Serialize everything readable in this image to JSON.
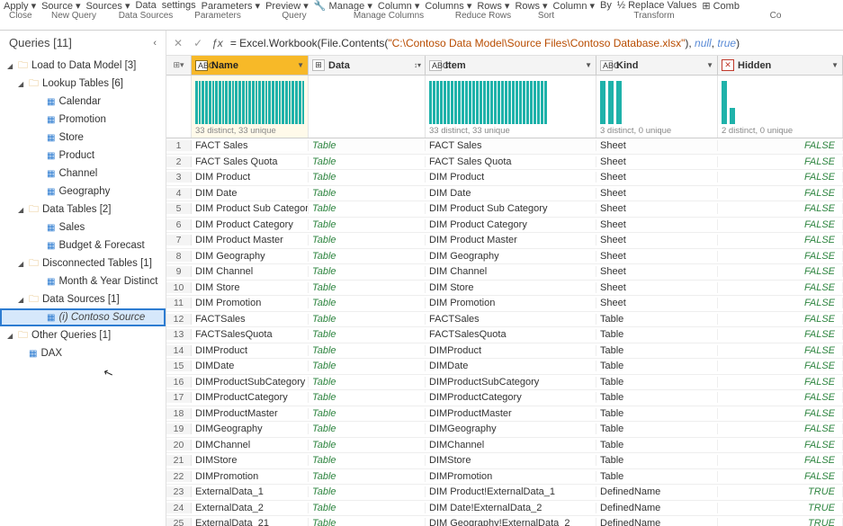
{
  "ribbon": {
    "top": [
      "Apply ▾",
      "Source ▾",
      "Sources ▾",
      "Data",
      "settings",
      "Parameters ▾",
      "Preview ▾",
      "🔧 Manage ▾",
      "Column ▾",
      "Columns ▾",
      "Rows ▾",
      "Rows ▾",
      "Column ▾",
      "By",
      "½ Replace Values",
      "⊞ Comb"
    ],
    "groups": {
      "close": "Close",
      "newq": "New Query",
      "ds": "Data Sources",
      "param": "Parameters",
      "query": "Query",
      "mc": "Manage Columns",
      "rr": "Reduce Rows",
      "sort": "Sort",
      "tr": "Transform",
      "co": "Co"
    }
  },
  "sidebar": {
    "title": "Queries [11]",
    "root": {
      "label": "Load to Data Model [3]"
    },
    "groups": [
      {
        "label": "Lookup Tables [6]",
        "items": [
          "Calendar",
          "Promotion",
          "Store",
          "Product",
          "Channel",
          "Geography"
        ]
      },
      {
        "label": "Data Tables [2]",
        "items": [
          "Sales",
          "Budget & Forecast"
        ]
      },
      {
        "label": "Disconnected Tables [1]",
        "items": [
          "Month & Year Distinct"
        ]
      },
      {
        "label": "Data Sources [1]",
        "items_special": [
          {
            "label": "(i) Contoso Source",
            "selected": true
          }
        ]
      }
    ],
    "other": {
      "label": "Other Queries [1]",
      "items": [
        "DAX"
      ]
    }
  },
  "formula": {
    "eq": "= ",
    "fn1": "Excel.Workbook",
    "lp1": "(",
    "fn2": "File.Contents",
    "lp2": "(",
    "str": "\"C:\\Contoso Data Model\\Source Files\\Contoso Database.xlsx\"",
    "rp2": "), ",
    "nul": "null",
    "comma": ", ",
    "tru": "true",
    "rp1": ")"
  },
  "columns": {
    "name": {
      "type": "ABC",
      "label": "Name"
    },
    "data": {
      "type": "⊞",
      "label": "Data"
    },
    "item": {
      "type": "ABC",
      "label": "Item"
    },
    "kind": {
      "type": "ABC",
      "label": "Kind"
    },
    "hidden": {
      "type": "✕",
      "label": "Hidden"
    }
  },
  "profiles": {
    "name": "33 distinct, 33 unique",
    "data": "",
    "item": "33 distinct, 33 unique",
    "kind": "3 distinct, 0 unique",
    "hidden": "2 distinct, 0 unique"
  },
  "table_word": "Table",
  "rows": [
    {
      "n": "FACT Sales",
      "i": "FACT Sales",
      "k": "Sheet",
      "h": "FALSE"
    },
    {
      "n": "FACT Sales Quota",
      "i": "FACT Sales Quota",
      "k": "Sheet",
      "h": "FALSE"
    },
    {
      "n": "DIM Product",
      "i": "DIM Product",
      "k": "Sheet",
      "h": "FALSE"
    },
    {
      "n": "DIM Date",
      "i": "DIM Date",
      "k": "Sheet",
      "h": "FALSE"
    },
    {
      "n": "DIM Product Sub Category",
      "i": "DIM Product Sub Category",
      "k": "Sheet",
      "h": "FALSE"
    },
    {
      "n": "DIM Product Category",
      "i": "DIM Product Category",
      "k": "Sheet",
      "h": "FALSE"
    },
    {
      "n": "DIM Product Master",
      "i": "DIM Product Master",
      "k": "Sheet",
      "h": "FALSE"
    },
    {
      "n": "DIM Geography",
      "i": "DIM Geography",
      "k": "Sheet",
      "h": "FALSE"
    },
    {
      "n": "DIM Channel",
      "i": "DIM Channel",
      "k": "Sheet",
      "h": "FALSE"
    },
    {
      "n": "DIM Store",
      "i": "DIM Store",
      "k": "Sheet",
      "h": "FALSE"
    },
    {
      "n": "DIM Promotion",
      "i": "DIM Promotion",
      "k": "Sheet",
      "h": "FALSE"
    },
    {
      "n": "FACTSales",
      "i": "FACTSales",
      "k": "Table",
      "h": "FALSE"
    },
    {
      "n": "FACTSalesQuota",
      "i": "FACTSalesQuota",
      "k": "Table",
      "h": "FALSE"
    },
    {
      "n": "DIMProduct",
      "i": "DIMProduct",
      "k": "Table",
      "h": "FALSE"
    },
    {
      "n": "DIMDate",
      "i": "DIMDate",
      "k": "Table",
      "h": "FALSE"
    },
    {
      "n": "DIMProductSubCategory",
      "i": "DIMProductSubCategory",
      "k": "Table",
      "h": "FALSE"
    },
    {
      "n": "DIMProductCategory",
      "i": "DIMProductCategory",
      "k": "Table",
      "h": "FALSE"
    },
    {
      "n": "DIMProductMaster",
      "i": "DIMProductMaster",
      "k": "Table",
      "h": "FALSE"
    },
    {
      "n": "DIMGeography",
      "i": "DIMGeography",
      "k": "Table",
      "h": "FALSE"
    },
    {
      "n": "DIMChannel",
      "i": "DIMChannel",
      "k": "Table",
      "h": "FALSE"
    },
    {
      "n": "DIMStore",
      "i": "DIMStore",
      "k": "Table",
      "h": "FALSE"
    },
    {
      "n": "DIMPromotion",
      "i": "DIMPromotion",
      "k": "Table",
      "h": "FALSE"
    },
    {
      "n": "ExternalData_1",
      "i": "DIM Product!ExternalData_1",
      "k": "DefinedName",
      "h": "TRUE"
    },
    {
      "n": "ExternalData_2",
      "i": "DIM Date!ExternalData_2",
      "k": "DefinedName",
      "h": "TRUE"
    },
    {
      "n": "ExternalData_21",
      "i": "DIM Geography!ExternalData_2",
      "k": "DefinedName",
      "h": "TRUE"
    }
  ]
}
